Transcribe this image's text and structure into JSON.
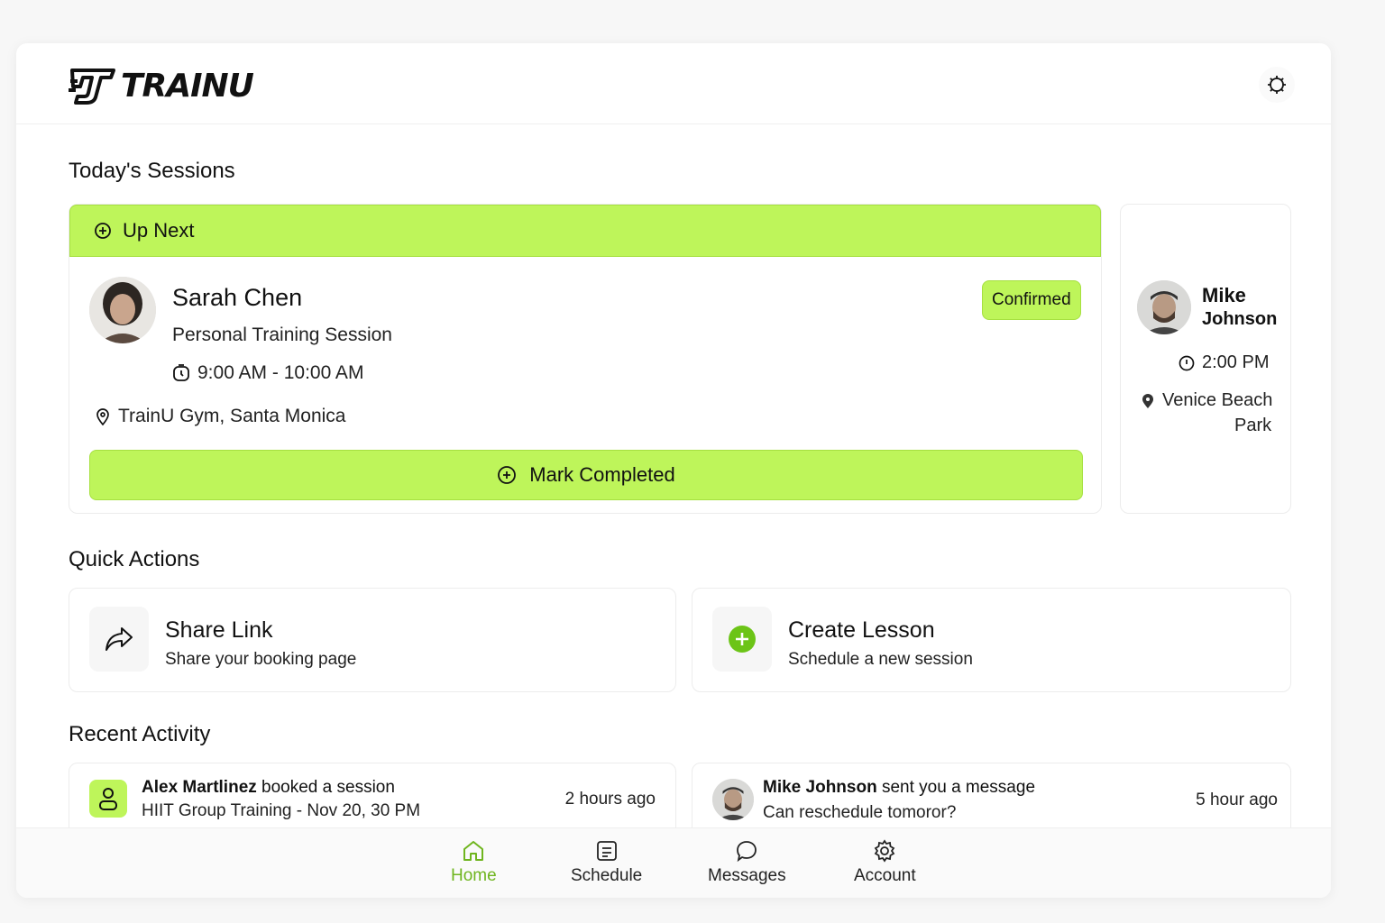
{
  "app": {
    "logo_text": "TRAINU"
  },
  "colors": {
    "accent": "#bef55a",
    "accent_border": "#a6e040",
    "active_nav": "#6fb51e",
    "create_icon": "#6cc417"
  },
  "icons": {
    "settings": "gear-icon",
    "upnext": "plus-circle-icon",
    "clock": "clock-icon",
    "location": "pin-icon",
    "share": "share-arrow-icon",
    "create": "plus-circle-filled-icon",
    "user": "user-icon",
    "home": "home-icon",
    "schedule": "schedule-icon",
    "messages": "chat-icon",
    "account": "gear-icon"
  },
  "sessions": {
    "title": "Today's Sessions",
    "up_next_label": "Up Next",
    "primary": {
      "name": "Sarah Chen",
      "type": "Personal Training Session",
      "time": "9:00 AM - 10:00 AM",
      "location": "TrainU Gym, Santa Monica",
      "status": "Confirmed",
      "action_label": "Mark Completed"
    },
    "secondary": {
      "first_name": "Mike",
      "last_name": "Johnson",
      "time": "2:00 PM",
      "location_line1": "Venice Beach",
      "location_line2": "Park"
    }
  },
  "quick_actions": {
    "title": "Quick Actions",
    "items": [
      {
        "title": "Share Link",
        "subtitle": "Share your booking page"
      },
      {
        "title": "Create Lesson",
        "subtitle": "Schedule a new session"
      }
    ]
  },
  "activity": {
    "title": "Recent Activity",
    "items": [
      {
        "name": "Alex Martlinez",
        "action": " booked a session",
        "detail": "HIIT Group Training - Nov 20, 30 PM",
        "time": "2 hours ago"
      },
      {
        "name": "Mike Johnson",
        "action": " sent you a message",
        "detail": "Can reschedule tomoror?",
        "time": "5 hour ago"
      }
    ]
  },
  "nav": {
    "items": [
      {
        "label": "Home",
        "active": true
      },
      {
        "label": "Schedule",
        "active": false
      },
      {
        "label": "Messages",
        "active": false
      },
      {
        "label": "Account",
        "active": false
      }
    ]
  }
}
